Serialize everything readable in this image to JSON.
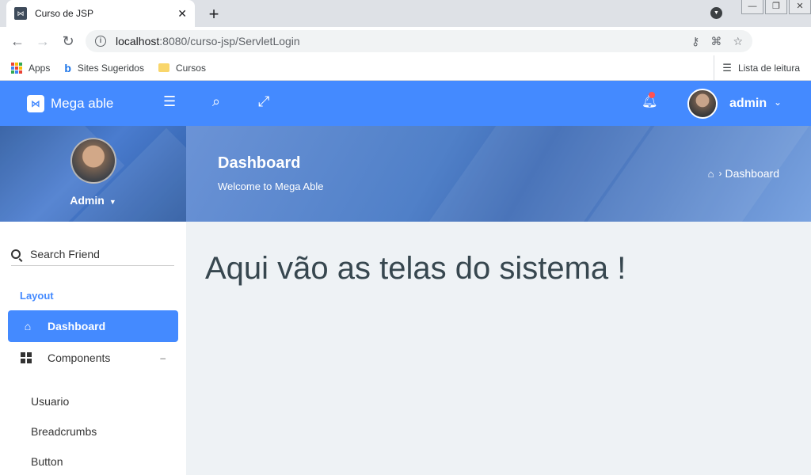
{
  "browser": {
    "tab_title": "Curso de JSP",
    "url_host": "localhost",
    "url_rest": ":8080/curso-jsp/ServletLogin",
    "bookmarks": [
      {
        "label": "Apps",
        "icon": "apps-grid-icon"
      },
      {
        "label": "Sites Sugeridos",
        "icon": "bing-icon"
      },
      {
        "label": "Cursos",
        "icon": "folder-icon"
      }
    ],
    "reading_list": "Lista de leitura"
  },
  "header": {
    "brand": "Mega able",
    "user": "admin",
    "accent": "#448aff",
    "notification_dot": "#ff5252"
  },
  "sidebar": {
    "profile_name": "Admin",
    "search_placeholder": "Search Friend",
    "section": "Layout",
    "items": [
      {
        "label": "Dashboard",
        "icon": "home-icon",
        "active": true
      },
      {
        "label": "Components",
        "icon": "grid-icon",
        "active": false
      }
    ],
    "sub_items": [
      "Usuario",
      "Breadcrumbs",
      "Button"
    ]
  },
  "page": {
    "title": "Dashboard",
    "subtitle": "Welcome to Mega Able",
    "breadcrumb": "Dashboard",
    "content_text": "Aqui vão as telas do sistema !"
  }
}
